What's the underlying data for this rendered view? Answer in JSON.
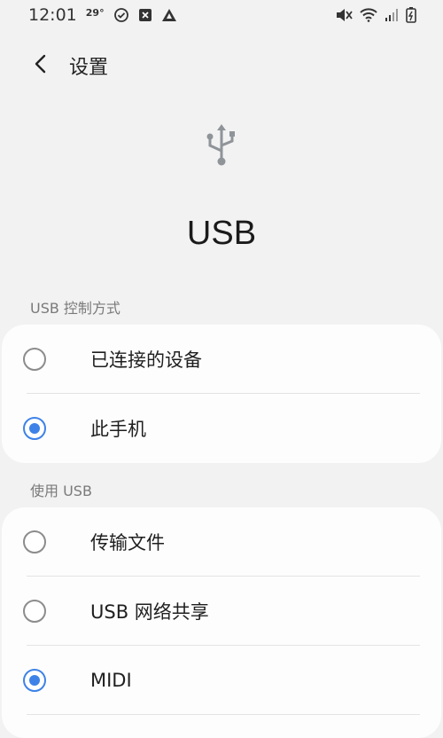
{
  "status_bar": {
    "time": "12:01",
    "temperature": "29°",
    "left_icons": [
      "check-circle-icon",
      "close-box-icon",
      "app-logo-icon"
    ],
    "right_icons": [
      "mute-icon",
      "wifi-icon",
      "signal-icon",
      "battery-icon"
    ]
  },
  "header": {
    "title": "设置",
    "back_icon": "chevron-left-icon"
  },
  "page": {
    "icon": "usb-icon",
    "title": "USB"
  },
  "sections": {
    "control": {
      "label": "USB 控制方式",
      "options": [
        {
          "label": "已连接的设备",
          "checked": false
        },
        {
          "label": "此手机",
          "checked": true
        }
      ]
    },
    "use": {
      "label": "使用 USB",
      "options": [
        {
          "label": "传输文件",
          "checked": false
        },
        {
          "label": "USB 网络共享",
          "checked": false
        },
        {
          "label": "MIDI",
          "checked": true
        }
      ]
    }
  },
  "colors": {
    "accent": "#3e82e8",
    "background": "#f2f2f2",
    "card": "#fdfdfd"
  }
}
